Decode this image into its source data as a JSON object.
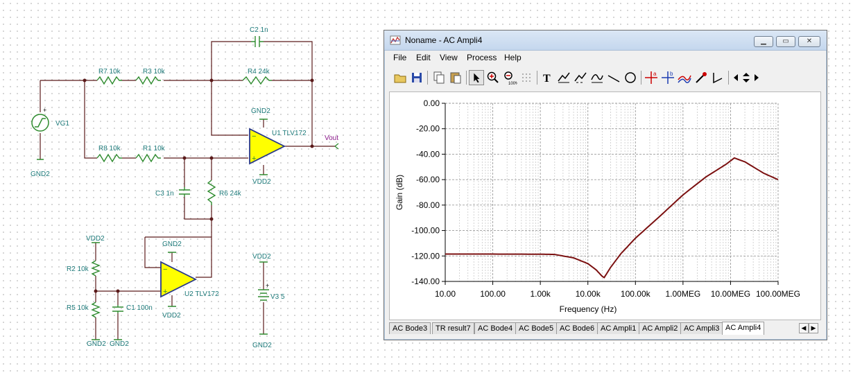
{
  "schematic": {
    "labels": {
      "c2": "C2 1n",
      "r7": "R7 10k",
      "r3": "R3 10k",
      "r4": "R4 24k",
      "vg1": "VG1",
      "gnd_vg1": "GND2",
      "u1_gnd": "GND2",
      "u1": "U1 TLV172",
      "vout": "Vout",
      "u1_vdd": "VDD2",
      "r8": "R8 10k",
      "r1": "R1 10k",
      "c3": "C3 1n",
      "r6": "R6 24k",
      "vdd_r2": "VDD2",
      "r2": "R2 10k",
      "r5": "R5 10k",
      "c1": "C1 100n",
      "gnd_r5": "GND2",
      "gnd_c1": "GND2",
      "u2_gnd": "GND2",
      "u2": "U2 TLV172",
      "u2_vdd": "VDD2",
      "v3_vdd": "VDD2",
      "v3": "V3 5",
      "v3_gnd": "GND2"
    }
  },
  "window": {
    "title": "Noname - AC Ampli4",
    "menu": [
      "File",
      "Edit",
      "View",
      "Process",
      "Help"
    ],
    "toolbar": [
      "open-icon",
      "save-icon",
      "copy-icon",
      "paste-icon",
      "pointer-icon",
      "zoom-in-icon",
      "zoom-100-icon",
      "grid-icon",
      "text-icon",
      "curve-tool-1-icon",
      "curve-tool-2-icon",
      "curve-tool-3-icon",
      "line-icon",
      "circle-icon",
      "cursor-a-icon",
      "cursor-b-icon",
      "cursor-curve-icon",
      "probe-icon",
      "angle-icon",
      "nav-left-icon",
      "nav-updown-icon",
      "nav-right-icon"
    ],
    "tabs": [
      "AC Bode3",
      "TR result7",
      "AC Bode4",
      "AC Bode5",
      "AC Bode6",
      "AC Ampli1",
      "AC Ampli2",
      "AC Ampli3",
      "AC Ampli4"
    ],
    "active_tab": "AC Ampli4"
  },
  "chart_data": {
    "type": "line",
    "title": "",
    "xlabel": "Frequency (Hz)",
    "ylabel": "Gain (dB)",
    "xscale": "log",
    "xlim": [
      10,
      100000000
    ],
    "ylim": [
      -140,
      0
    ],
    "xticks": [
      "10.00",
      "100.00",
      "1.00k",
      "10.00k",
      "100.00k",
      "1.00MEG",
      "10.00MEG",
      "100.00MEG"
    ],
    "yticks": [
      "0.00",
      "-20.00",
      "-40.00",
      "-60.00",
      "-80.00",
      "-100.00",
      "-120.00",
      "-140.00"
    ],
    "grid": true,
    "series": [
      {
        "color": "#7b1010",
        "x": [
          10,
          100,
          1000,
          2000,
          5000,
          10000,
          15000,
          20000,
          22000,
          30000,
          50000,
          100000,
          300000,
          1000000,
          3000000,
          8000000,
          12000000,
          20000000,
          50000000,
          100000000
        ],
        "y": [
          -118.5,
          -118.5,
          -118.6,
          -118.8,
          -121.5,
          -126,
          -131,
          -136,
          -137,
          -129,
          -118,
          -106,
          -90,
          -72,
          -58,
          -48,
          -43,
          -46,
          -55,
          -60
        ]
      }
    ]
  }
}
